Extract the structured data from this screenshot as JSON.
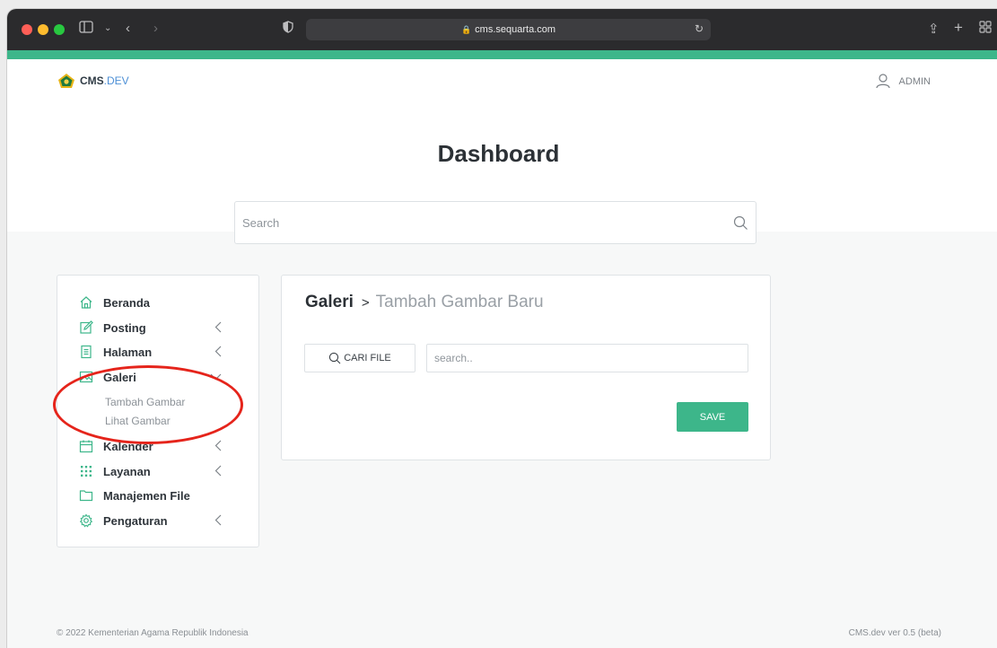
{
  "browser": {
    "url": "cms.sequarta.com"
  },
  "header": {
    "brand_main": "CMS",
    "brand_suffix": ".DEV",
    "user_label": "ADMIN"
  },
  "page": {
    "title": "Dashboard"
  },
  "search": {
    "placeholder": "Search"
  },
  "sidebar": {
    "items": [
      {
        "label": "Beranda",
        "icon": "home-icon"
      },
      {
        "label": "Posting",
        "icon": "edit-icon"
      },
      {
        "label": "Halaman",
        "icon": "document-icon"
      },
      {
        "label": "Galeri",
        "icon": "image-icon"
      },
      {
        "label": "Kalender",
        "icon": "calendar-icon"
      },
      {
        "label": "Layanan",
        "icon": "grid-icon"
      },
      {
        "label": "Manajemen File",
        "icon": "folder-icon"
      },
      {
        "label": "Pengaturan",
        "icon": "gear-icon"
      }
    ],
    "galeri_subitems": [
      "Tambah Gambar",
      "Lihat Gambar"
    ]
  },
  "panel": {
    "breadcrumb_parent": "Galeri",
    "breadcrumb_separator": ">",
    "breadcrumb_current": "Tambah Gambar Baru",
    "cari_file_label": "CARI FILE",
    "search_placeholder": "search..",
    "save_label": "SAVE"
  },
  "footer": {
    "copyright": "© 2022 Kementerian Agama Republik Indonesia",
    "version": "CMS.dev ver 0.5 (beta)"
  },
  "colors": {
    "accent": "#3db68a",
    "annotation": "#e5241b"
  }
}
